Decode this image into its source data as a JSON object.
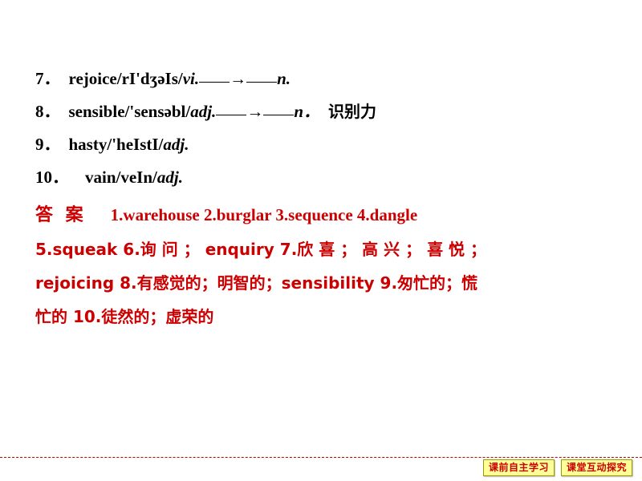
{
  "slide": {
    "vocab_items": [
      {
        "number": "7．",
        "word": "rejoice/r",
        "phonetic": "I'dʒəIs/",
        "pos1": "vi.",
        "arrow": "→",
        "pos2": "n.",
        "chinese": ""
      },
      {
        "number": "8．",
        "word": "sensible/",
        "phonetic": "'sensəbl/",
        "pos1": "adj.",
        "arrow": "→",
        "pos2": "n．",
        "chinese": "识别力"
      },
      {
        "number": "9．",
        "word": "hasty/",
        "phonetic": "'heIstI/",
        "pos1": "adj.",
        "arrow": "",
        "pos2": "",
        "chinese": ""
      },
      {
        "number": "10．",
        "word": "vain/",
        "phonetic": "veIn/",
        "pos1": "adj.",
        "arrow": "",
        "pos2": "",
        "chinese": ""
      }
    ],
    "answer_label": "答 案",
    "answer_lines": [
      "1.warehouse    2.burglar    3.sequence    4.dangle",
      "5.squeak    6.询 问 ； enquiry    7.欣 喜 ； 高 兴 ； 喜 悦 ；",
      "rejoicing    8.有感觉的；明智的；sensibility    9.匆忙的；慌",
      "忙的   10.徒然的；虚荣的"
    ],
    "footer": {
      "tab1": "课前自主学习",
      "tab2": "课堂互动探究"
    }
  }
}
